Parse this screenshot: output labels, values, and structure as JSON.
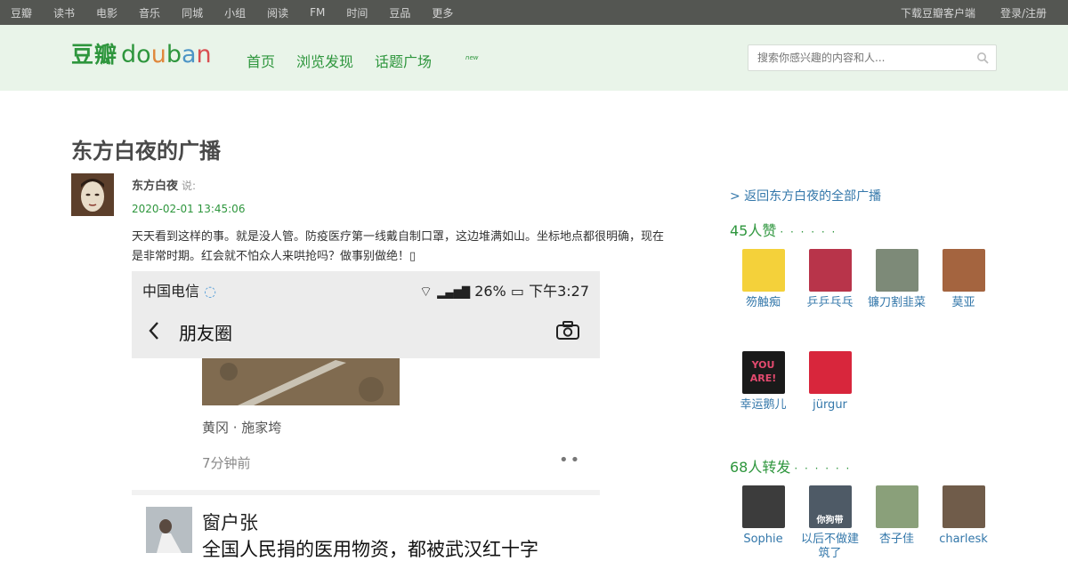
{
  "topbar": {
    "left": [
      "豆瓣",
      "读书",
      "电影",
      "音乐",
      "同城",
      "小组",
      "阅读",
      "FM",
      "时间",
      "豆品",
      "更多"
    ],
    "right": [
      "下载豆瓣客户端",
      "登录/注册"
    ]
  },
  "header": {
    "logo_cn": "豆瓣",
    "logo_en": [
      "d",
      "o",
      "u",
      "b",
      "a",
      "n"
    ],
    "logo_en_colors": [
      "#2e963d",
      "#2e963d",
      "#e0883c",
      "#2e963d",
      "#4d95c6",
      "#d94e51"
    ],
    "nav": [
      "首页",
      "浏览发现",
      "话题广场"
    ],
    "new_badge": "new",
    "search_placeholder": "搜索你感兴趣的内容和人..."
  },
  "page_title": "东方白夜的广播",
  "status": {
    "author": "东方白夜",
    "says": "说:",
    "time": "2020-02-01 13:45:06",
    "text": "天天看到这样的事。就是没人管。防疫医疗第一线戴自制口罩，这边堆满如山。坐标地点都很明确，现在是非常时期。红会就不怕众人来哄抢吗？做事别做绝！▯"
  },
  "screenshot": {
    "carrier": "中国电信",
    "status_right": "26%",
    "clock": "下午3:27",
    "title": "朋友圈",
    "location": "黄冈 · 施家垮",
    "ago": "7分钟前",
    "poster": "窗户张",
    "post_text": "全国人民捐的医用物资，都被武汉红十字"
  },
  "sidebar": {
    "back_link": "> 返回东方白夜的全部广播",
    "likes_title": "45人赞",
    "dots": "· · · · · ·",
    "likes": [
      {
        "name": "笏触痴",
        "color": "#f4d13a"
      },
      {
        "name": "乒乒乓乓",
        "color": "#b8344a"
      },
      {
        "name": "镰刀割韭菜",
        "color": "#7d8a78"
      },
      {
        "name": "莫亚",
        "color": "#a4643f"
      },
      {
        "name": "幸运鹅儿",
        "color": "#1a1a1a",
        "badge": "YOU ARE!"
      },
      {
        "name": "jürgur",
        "color": "#d8263c"
      }
    ],
    "reshare_title": "68人转发",
    "reshares": [
      {
        "name": "Sophie",
        "color": "#3c3c3c"
      },
      {
        "name": "以后不做建筑了",
        "color": "#4e5a66",
        "badge": "你狗带"
      },
      {
        "name": "杏子佳",
        "color": "#8aa07a"
      },
      {
        "name": "charlesk",
        "color": "#705c4a"
      }
    ]
  }
}
